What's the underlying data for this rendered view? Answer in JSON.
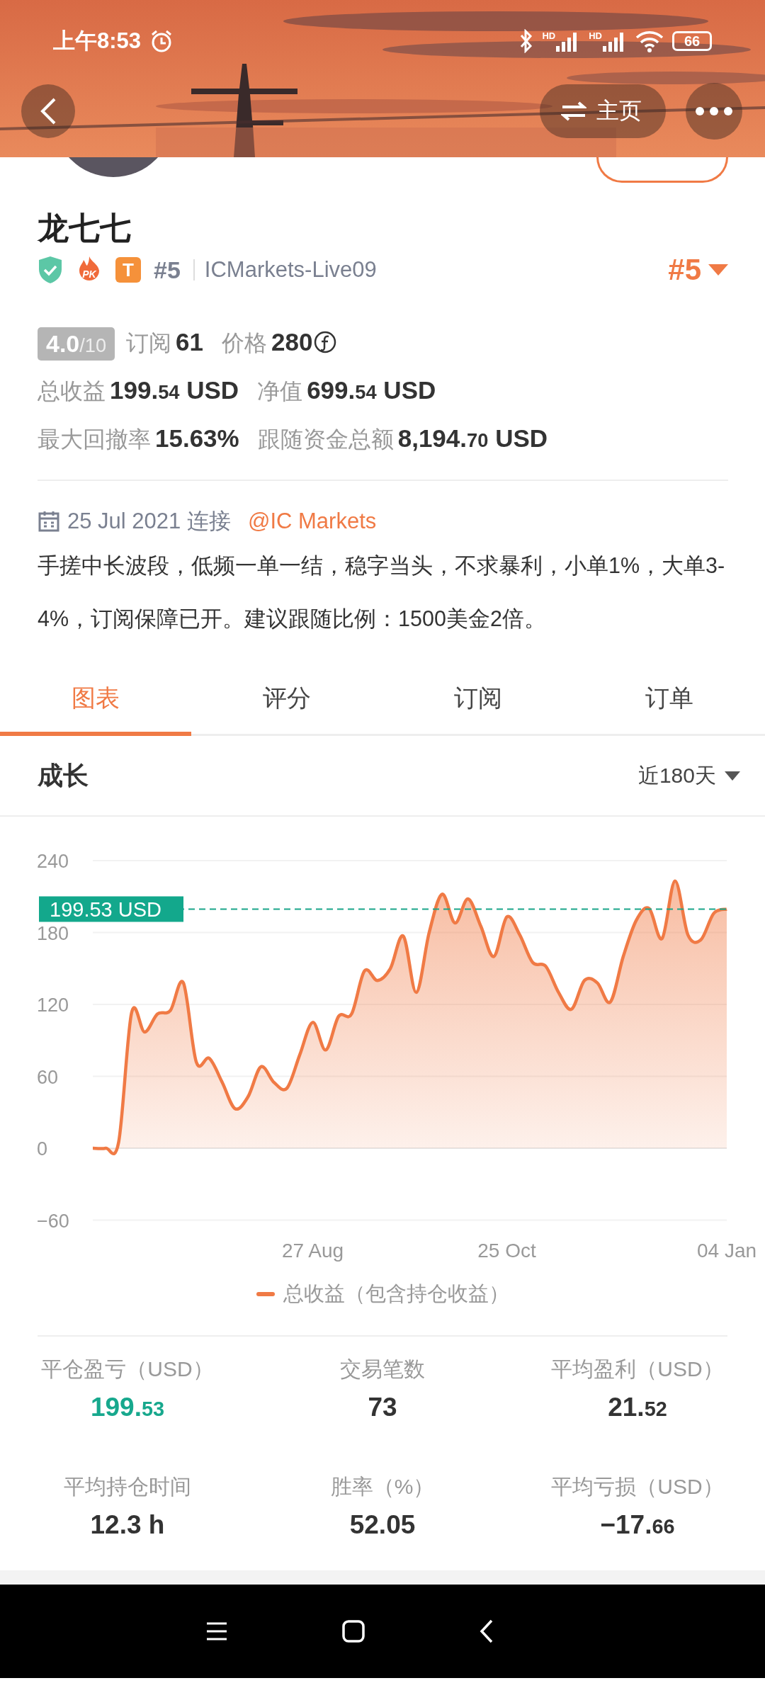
{
  "status_bar": {
    "time": "上午8:53",
    "signals": [
      {
        "label": "HD"
      },
      {
        "label": "HD"
      }
    ],
    "battery": "66"
  },
  "header": {
    "home_button": "主页"
  },
  "profile": {
    "name": "龙七七",
    "badges": [
      {
        "kind": "shield"
      },
      {
        "kind": "flame",
        "text": "PK"
      },
      {
        "kind": "letter",
        "text": "T"
      }
    ],
    "rank": "#5",
    "server": "ICMarkets-Live09",
    "rank_dropdown": "#5",
    "rating": {
      "score": "4.0",
      "scale": "/10"
    },
    "metric_rows": [
      [
        {
          "label": "订阅",
          "value": "61",
          "coin": false
        },
        {
          "label": "价格",
          "value": "280",
          "coin": true
        }
      ],
      [
        {
          "label": "总收益",
          "value": "199.54 USD",
          "small_decimals": true,
          "coin": false
        },
        {
          "label": "净值",
          "value": "699.54 USD",
          "small_decimals": true,
          "coin": false
        }
      ],
      [
        {
          "label": "最大回撤率",
          "value": "15.63%",
          "small_decimals": false,
          "coin": false
        },
        {
          "label": "跟随资金总额",
          "value": "8,194.70 USD",
          "small_decimals": true,
          "coin": false
        }
      ]
    ],
    "joined": {
      "text": "25 Jul 2021 连接",
      "link": "@IC Markets"
    },
    "description": "手搓中长波段，低频一单一结，稳字当头，不求暴利，小单1%，大单3-4%，订阅保障已开。建议跟随比例：1500美金2倍。"
  },
  "tabs": [
    {
      "label": "图表",
      "selected": true
    },
    {
      "label": "评分",
      "selected": false
    },
    {
      "label": "订阅",
      "selected": false
    },
    {
      "label": "订单",
      "selected": false
    }
  ],
  "growth": {
    "title": "成长",
    "period": "近180天",
    "chart_data": {
      "type": "area",
      "categories": [
        null,
        null,
        null,
        null,
        null,
        null,
        null,
        null,
        null,
        null,
        null,
        null,
        null,
        null,
        null,
        null,
        null,
        "27 Aug",
        null,
        null,
        null,
        null,
        null,
        null,
        null,
        null,
        null,
        null,
        null,
        null,
        null,
        null,
        "25 Oct",
        null,
        null,
        null,
        null,
        null,
        null,
        null,
        null,
        null,
        null,
        null,
        null,
        null,
        null,
        null,
        null,
        "04 Jan"
      ],
      "series": [
        {
          "name": "总收益（包含持仓收益）",
          "color": "#f07a45",
          "values": [
            0,
            0,
            5,
            113,
            97,
            112,
            115,
            138,
            72,
            75,
            55,
            33,
            43,
            68,
            55,
            50,
            78,
            105,
            82,
            110,
            112,
            148,
            140,
            150,
            177,
            130,
            180,
            212,
            188,
            208,
            185,
            160,
            193,
            178,
            155,
            152,
            130,
            116,
            140,
            138,
            122,
            160,
            190,
            200,
            175,
            223,
            178,
            174,
            196,
            199.5
          ]
        }
      ],
      "ylim": [
        -60,
        240
      ],
      "yticks": [
        -60,
        0,
        60,
        120,
        180,
        240
      ],
      "grid": true,
      "ref_lines": [
        {
          "axis": "y",
          "value": 199.53,
          "label": "199.53 USD"
        }
      ]
    }
  },
  "stats": [
    {
      "label": "平仓盈亏（USD）",
      "value": "199.53",
      "small_decimals": true,
      "positive": true
    },
    {
      "label": "交易笔数",
      "value": "73",
      "positive": false
    },
    {
      "label": "平均盈利（USD）",
      "value": "21.52",
      "small_decimals": true,
      "positive": false
    },
    {
      "label": "平均持仓时间",
      "value": "12.3 h",
      "positive": false
    },
    {
      "label": "胜率（%）",
      "value": "52.05",
      "small_decimals": false,
      "positive": false
    },
    {
      "label": "平均亏损（USD）",
      "value": "−17.66",
      "small_decimals": true,
      "positive": false
    }
  ]
}
